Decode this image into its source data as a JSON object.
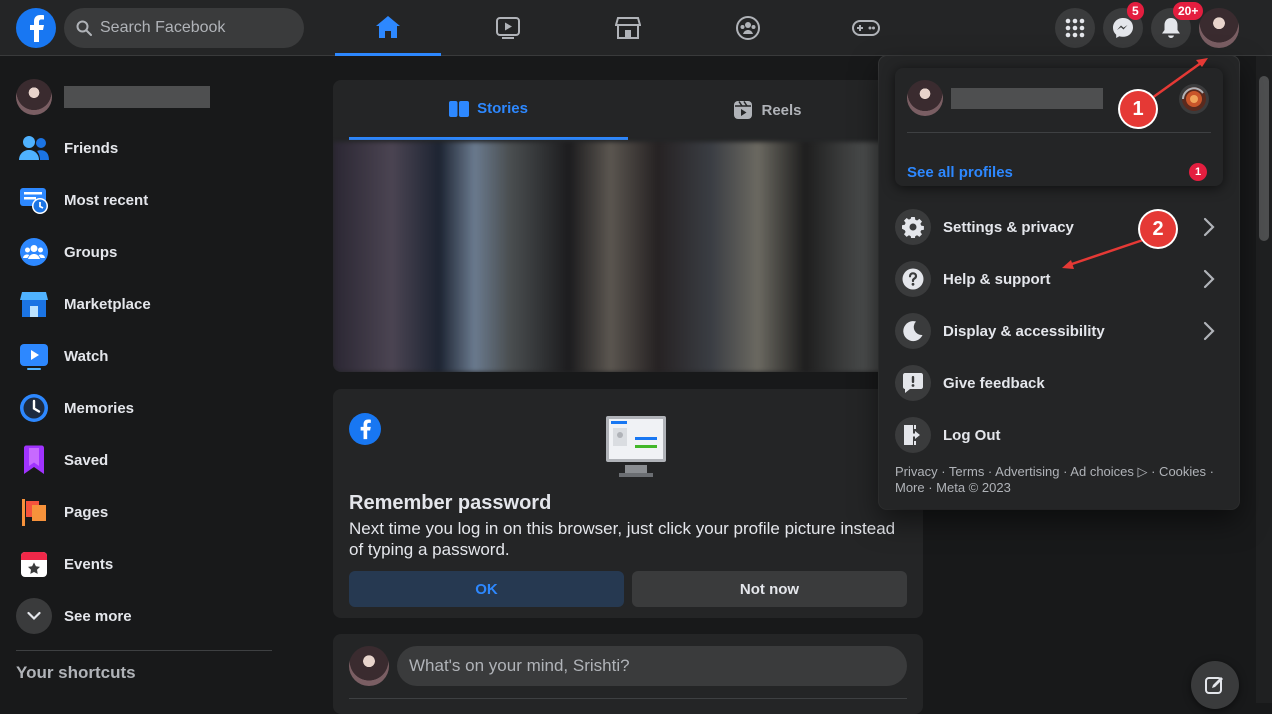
{
  "header": {
    "search_placeholder": "Search Facebook",
    "messenger_badge": "5",
    "notifications_badge": "20+"
  },
  "sidebar": {
    "items": [
      {
        "label": "Friends"
      },
      {
        "label": "Most recent"
      },
      {
        "label": "Groups"
      },
      {
        "label": "Marketplace"
      },
      {
        "label": "Watch"
      },
      {
        "label": "Memories"
      },
      {
        "label": "Saved"
      },
      {
        "label": "Pages"
      },
      {
        "label": "Events"
      },
      {
        "label": "See more"
      }
    ],
    "shortcuts_heading": "Your shortcuts"
  },
  "stories": {
    "tabs": [
      {
        "label": "Stories"
      },
      {
        "label": "Reels"
      }
    ]
  },
  "remember": {
    "title": "Remember password",
    "text": "Next time you log in on this browser, just click your profile picture instead of typing a password.",
    "ok_label": "OK",
    "not_now_label": "Not now"
  },
  "composer": {
    "placeholder": "What's on your mind, Srishti?"
  },
  "menu": {
    "see_all_profiles": "See all profiles",
    "see_all_badge": "1",
    "items": [
      {
        "label": "Settings & privacy",
        "icon": "gear-icon",
        "has_arrow": true
      },
      {
        "label": "Help & support",
        "icon": "question-icon",
        "has_arrow": true
      },
      {
        "label": "Display & accessibility",
        "icon": "moon-icon",
        "has_arrow": true
      },
      {
        "label": "Give feedback",
        "icon": "feedback-icon",
        "has_arrow": false
      },
      {
        "label": "Log Out",
        "icon": "logout-icon",
        "has_arrow": false
      }
    ],
    "footer_line1": "Privacy · Terms · Advertising · Ad choices ▷ · Cookies ·",
    "footer_line2": "More · Meta © 2023"
  },
  "annotations": {
    "step1": "1",
    "step2": "2",
    "color": "#e53935"
  },
  "colors": {
    "accent": "#2d88ff",
    "badge": "#e41e3f",
    "surface": "#242526",
    "background": "#18191a"
  }
}
